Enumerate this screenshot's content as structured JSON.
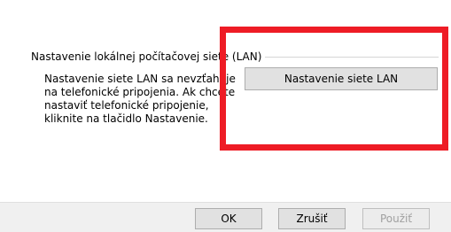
{
  "lan_group": {
    "title": "Nastavenie lokálnej počítačovej siete (LAN)",
    "description": "Nastavenie siete LAN sa nevzťahuje\nna telefonické pripojenia. Ak chcete\nnastaviť telefonické pripojenie,\nkliknite na tlačidlo Nastavenie.",
    "button_label": "Nastavenie siete LAN"
  },
  "footer": {
    "ok_label": "OK",
    "cancel_label": "Zrušiť",
    "apply_label": "Použiť"
  },
  "colors": {
    "highlight": "#ee1c25",
    "button_bg": "#e1e1e1",
    "footer_bg": "#f0f0f0",
    "disabled_text": "#a0a0a0"
  }
}
